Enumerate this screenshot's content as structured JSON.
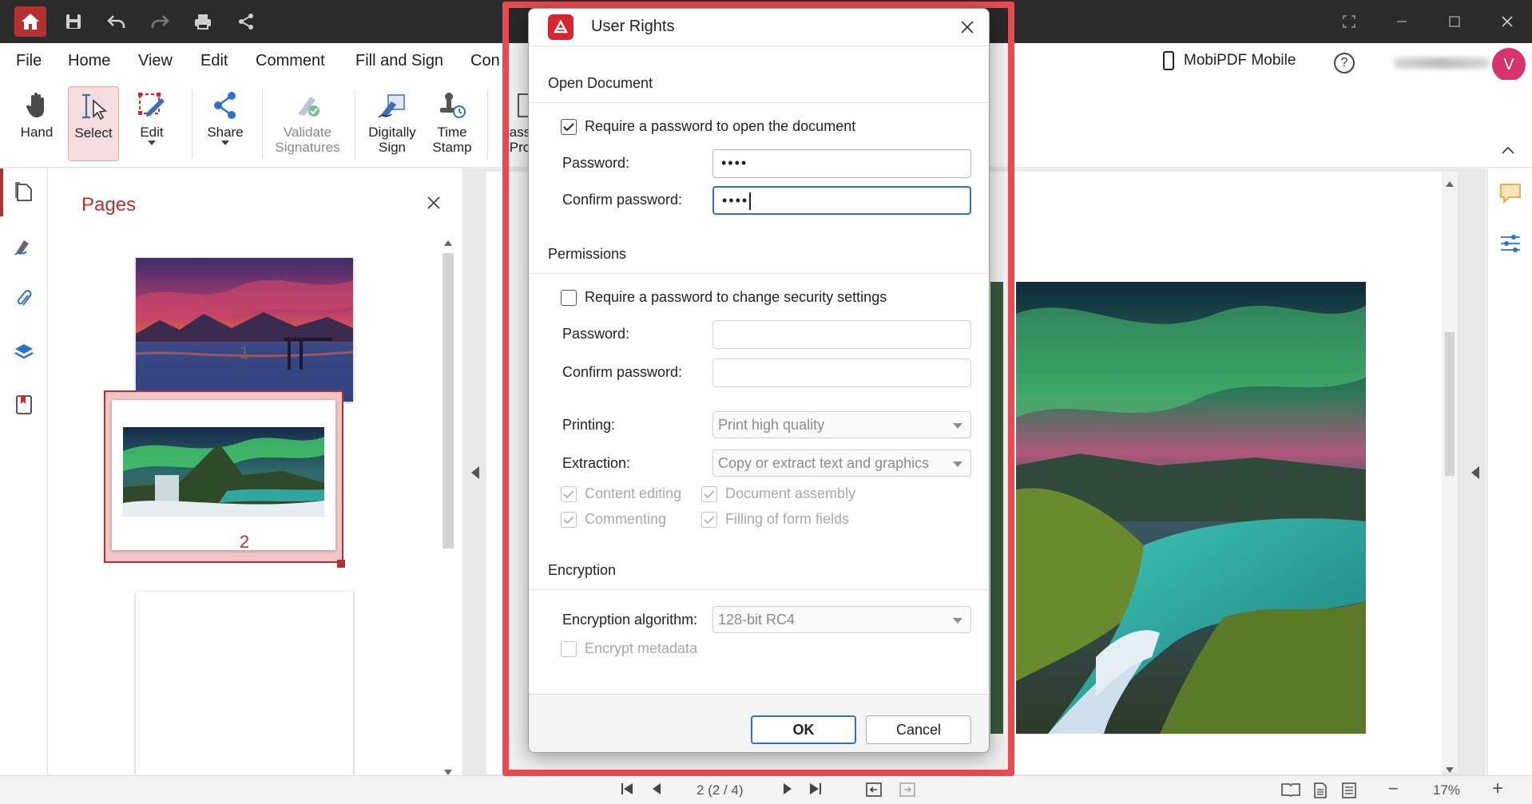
{
  "menu": [
    "File",
    "Home",
    "View",
    "Edit",
    "Comment",
    "Fill and Sign",
    "Con"
  ],
  "mobile_label": "MobiPDF Mobile",
  "help_glyph": "?",
  "avatar_letter": "V",
  "ribbon": {
    "hand": "Hand",
    "select": "Select",
    "edit": "Edit",
    "share": "Share",
    "validate": [
      "Validate",
      "Signatures"
    ],
    "digitally": [
      "Digitally",
      "Sign"
    ],
    "time": [
      "Time",
      "Stamp"
    ],
    "partial": [
      "ass",
      "Pro"
    ]
  },
  "pages_panel": {
    "title": "Pages",
    "page_numbers": [
      "1",
      "2"
    ]
  },
  "status_bar": {
    "page_indicator": "2 (2 / 4)",
    "zoom": "17%",
    "zoom_out": "−",
    "zoom_in": "+"
  },
  "dialog": {
    "title": "User Rights",
    "open_document": {
      "heading": "Open Document",
      "require_label": "Require a password to open the document",
      "require_checked": true,
      "password_label": "Password:",
      "password_value": "••••",
      "confirm_label": "Confirm password:",
      "confirm_value": "••••"
    },
    "permissions": {
      "heading": "Permissions",
      "require_label": "Require a password to change security settings",
      "require_checked": false,
      "password_label": "Password:",
      "confirm_label": "Confirm password:",
      "printing_label": "Printing:",
      "printing_value": "Print high quality",
      "extraction_label": "Extraction:",
      "extraction_value": "Copy or extract text and graphics",
      "content_editing": "Content editing",
      "document_assembly": "Document assembly",
      "commenting": "Commenting",
      "filling_fields": "Filling of form fields"
    },
    "encryption": {
      "heading": "Encryption",
      "algorithm_label": "Encryption algorithm:",
      "algorithm_value": "128-bit RC4",
      "encrypt_metadata": "Encrypt metadata"
    },
    "ok": "OK",
    "cancel": "Cancel"
  },
  "colors": {
    "accent": "#b5312f",
    "highlight_frame": "#e84a4f",
    "focus_blue": "#2b73c8"
  }
}
